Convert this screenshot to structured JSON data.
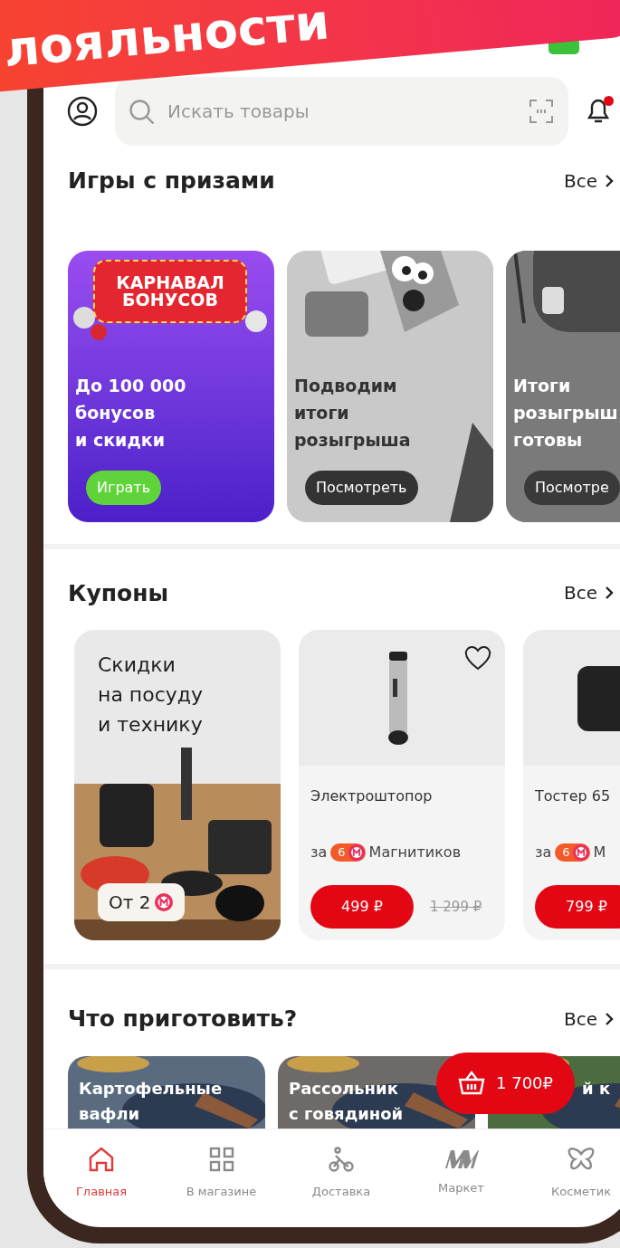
{
  "banner": {
    "text": "лояльности"
  },
  "search": {
    "placeholder": "Искать товары"
  },
  "notifications": {
    "unread": true
  },
  "games": {
    "title": "Игры с призами",
    "link": "Все",
    "cards": [
      {
        "kind": "carnival",
        "logo": [
          "КАРНАВАЛ",
          "БОНУСОВ"
        ],
        "lines": [
          "До 100 000",
          "бонусов",
          "и скидки"
        ],
        "button": "Играть"
      },
      {
        "kind": "mascot",
        "lines": [
          "Подводим",
          "итоги",
          "розыгрыша"
        ],
        "button": "Посмотреть"
      },
      {
        "kind": "backpack",
        "lines": [
          "Итоги",
          "розыгрыш",
          "готовы"
        ],
        "button": "Посмотре"
      }
    ]
  },
  "coupons": {
    "title": "Купоны",
    "link": "Все",
    "promo": {
      "lines": [
        "Скидки",
        "на посуду",
        "и технику"
      ],
      "from": "От 2"
    },
    "products": [
      {
        "name": "Электроштопор",
        "points_prefix": "за",
        "points": "6",
        "points_suffix": "Магнитиков",
        "price": "499 ₽",
        "old_price": "1 299 ₽",
        "favorite": false
      },
      {
        "name": "Тостер 65",
        "points_prefix": "за",
        "points": "6",
        "points_suffix": "М",
        "price": "799 ₽"
      }
    ]
  },
  "recipes": {
    "title": "Что приготовить?",
    "link": "Все",
    "cards": [
      {
        "lines": [
          "Картофельные",
          "вафли"
        ]
      },
      {
        "lines": [
          "Рассольник",
          "с говядиной"
        ]
      },
      {
        "lines": [
          "й к"
        ]
      }
    ]
  },
  "cart": {
    "total": "1 700₽"
  },
  "nav": [
    {
      "kind": "home",
      "label": "Главная",
      "selected": true
    },
    {
      "kind": "store",
      "label": "В магазине",
      "selected": false
    },
    {
      "kind": "delivery",
      "label": "Доставка",
      "selected": false
    },
    {
      "kind": "market",
      "label": "Маркет",
      "selected": false
    },
    {
      "kind": "cosmetics",
      "label": "Косметик",
      "selected": false
    }
  ]
}
